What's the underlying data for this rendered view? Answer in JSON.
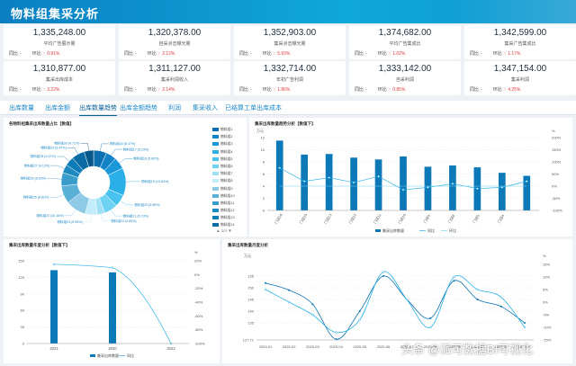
{
  "header": {
    "title": "物料组集采分析"
  },
  "kpis": [
    {
      "value": "1,335,248.00",
      "label": "平均广告展示量",
      "c1": "同比",
      "v1": "-",
      "c2": "环比",
      "v2": "0.81%",
      "dir": "up"
    },
    {
      "value": "1,320,378.00",
      "label": "自采点击曝光量",
      "c1": "同比",
      "v1": "-",
      "c2": "环比",
      "v2": "2.12%",
      "dir": "up"
    },
    {
      "value": "1,352,903.00",
      "label": "集采点击曝光量",
      "c1": "同比",
      "v1": "-",
      "c2": "环比",
      "v2": "5.93%",
      "dir": "up"
    },
    {
      "value": "1,374,682.00",
      "label": "平均广告集成比",
      "c1": "同比",
      "v1": "-",
      "c2": "环比",
      "v2": "1.02%",
      "dir": "up"
    },
    {
      "value": "1,342,599.00",
      "label": "集采广告集成比",
      "c1": "同比",
      "v1": "-",
      "c2": "环比",
      "v2": "1.17%",
      "dir": "up"
    },
    {
      "value": "1,310,877.00",
      "label": "集采出库成本",
      "c1": "同比",
      "v1": "-",
      "c2": "环比",
      "v2": "3.22%",
      "dir": "up"
    },
    {
      "value": "1,311,127.00",
      "label": "集采利润收入",
      "c1": "同比",
      "v1": "-",
      "c2": "环比",
      "v2": "2.14%",
      "dir": "up"
    },
    {
      "value": "1,332,714.00",
      "label": "年初广告利润",
      "c1": "同比",
      "v1": "-",
      "c2": "环比",
      "v2": "1.86%",
      "dir": "up"
    },
    {
      "value": "1,333,142.00",
      "label": "自采利润",
      "c1": "同比",
      "v1": "-",
      "c2": "环比",
      "v2": "0.85%",
      "dir": "up"
    },
    {
      "value": "1,347,154.00",
      "label": "集采利润",
      "c1": "同比",
      "v1": "-",
      "c2": "环比",
      "v2": "4.25%",
      "dir": "up"
    }
  ],
  "tabs": [
    "出库数量",
    "出库金额",
    "出库数量趋势",
    "出库金额趋势",
    "利润",
    "集采收入",
    "已结算工单出库成本"
  ],
  "panels": {
    "pie_title": "各物料组集采出库数量占比【数值】",
    "bar_title": "集采出库数量趋势分析【数值下】",
    "bottom_left_title": "集采出库数量年度分析【数值下】",
    "bottom_right_title": "集采出库数量月度分析"
  },
  "pager": "▲ 1/4 ▼",
  "watermark": "头条 @派可数据BI可视化",
  "colors": {
    "primary": "#0b78b8",
    "cyan": "#1fb6e0",
    "header": "#0a7fc2"
  },
  "chart_data": [
    {
      "type": "pie",
      "title": "",
      "categories": [
        "物料组16",
        "物料组17",
        "物料组18",
        "物料组19",
        "物料组20",
        "物料组21",
        "物料组22",
        "物料组23",
        "物料组24",
        "物料组25",
        "物料组26",
        "物料组27",
        "物料组28",
        "物料组29",
        "物料组30"
      ],
      "legend": [
        "物料组1",
        "物料组2",
        "物料组3",
        "物料组4",
        "物料组5",
        "物料组6",
        "物料组7",
        "物料组8",
        "物料组9",
        "物料组10",
        "物料组11",
        "物料组12",
        "物料组13",
        "物料组14"
      ],
      "labels": [
        "物料组16 (6.47%)",
        "物料组17 (5.23%)",
        "物料组18 (5.80%)",
        "物料组19 (13.84%)",
        "物料组20 (5.98%)",
        "物料组21 (6.73%)",
        "物料组22 (3.80%)",
        "物料组23 (5.96%)",
        "物料组24 (10.16%)",
        "物料组25 (8.81%)",
        "物料组26 (6.63%)",
        "物料组27 (4.13%)",
        "物料组28 (4.57%)",
        "物料组29 (6.47%)",
        "物料组30 (4.71%)"
      ],
      "values": [
        6.47,
        5.23,
        5.8,
        13.84,
        5.98,
        6.73,
        3.8,
        5.96,
        10.16,
        8.81,
        6.63,
        4.13,
        4.57,
        6.47,
        4.71
      ]
    },
    {
      "type": "bar",
      "title": "",
      "categories": [
        "门店16",
        "门店15",
        "门店13",
        "门店12",
        "门店11",
        "门店10",
        "门店9",
        "门店8",
        "门店5",
        "门店4"
      ],
      "series": [
        {
          "name": "集采出库数量",
          "type": "bar",
          "values": [
            11.5,
            9.2,
            9.3,
            8.7,
            8.4,
            8.9,
            7.2,
            7.4,
            7.1,
            6.2,
            5.7
          ]
        },
        {
          "name": "同比",
          "type": "line",
          "values": [
            75,
            20,
            35,
            15,
            40,
            -15,
            -5,
            10,
            -10,
            -5,
            20
          ]
        },
        {
          "name": "环比",
          "type": "line",
          "values": [
            0,
            0,
            0,
            0,
            0,
            0,
            0,
            0,
            0,
            0,
            0
          ]
        }
      ],
      "ylim": [
        0,
        12
      ],
      "y2lim": [
        -100,
        200
      ]
    },
    {
      "type": "bar",
      "title": "",
      "categories": [
        "2021",
        "2020",
        "2022"
      ],
      "series": [
        {
          "name": "集采出库数量",
          "type": "bar",
          "values": [
            133,
            129,
            0
          ]
        },
        {
          "name": "同比",
          "type": "line",
          "values": [
            15,
            10,
            -100
          ]
        }
      ],
      "ylim": [
        0,
        150
      ],
      "y2lim": [
        -100,
        20
      ]
    },
    {
      "type": "line",
      "title": "",
      "categories": [
        "2020-01",
        "2020-02",
        "2020-03",
        "2020-04",
        "2020-05",
        "2020-06",
        "2020-07",
        "2020-08",
        "2020-09",
        "2020-10",
        "2020-11",
        "2020-12"
      ],
      "series": [
        {
          "name": "集采出库数量",
          "values": [
            152,
            149,
            143,
            128,
            140,
            155,
            145,
            137,
            153,
            145,
            142,
            135
          ]
        },
        {
          "name": "同比",
          "values": [
            5,
            0,
            -5,
            -12,
            -7,
            12,
            1,
            -10,
            10,
            5,
            2,
            -10
          ]
        }
      ],
      "ylim": [
        127.71,
        160
      ],
      "y2lim": [
        -15,
        15
      ]
    }
  ]
}
